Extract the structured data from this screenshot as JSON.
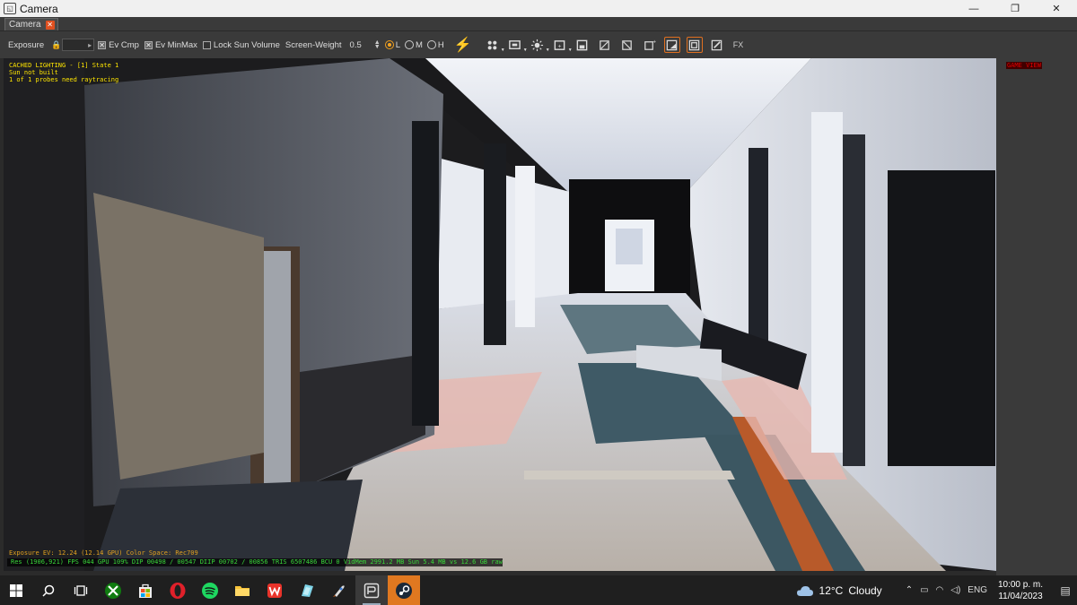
{
  "window": {
    "title": "Camera",
    "tab_label": "Camera"
  },
  "win_controls": {
    "minimize": "—",
    "restore": "❐",
    "close": "✕"
  },
  "toolbar": {
    "exposure_label": "Exposure",
    "ev_cmp_label": "Ev Cmp",
    "ev_minmax_label": "Ev MinMax",
    "lock_sun_volume_label": "Lock Sun Volume",
    "screen_weight_label": "Screen-Weight",
    "screen_weight_value": "0.5",
    "radio_l": "L",
    "radio_m": "M",
    "radio_h": "H",
    "selected_quality": "L",
    "ev_cmp_checked": true,
    "ev_minmax_checked": true,
    "lock_sun_volume_checked": false,
    "fx_label": "FX"
  },
  "viewport": {
    "status_lines": [
      "CACHED LIGHTING - [1] State 1",
      "Sun not built",
      "1 of 1 probes need raytracing"
    ],
    "game_view_label": "GAME VIEW",
    "exposure_line": "Exposure EV: 12.24 (12.14 GPU)  Color Space: Rec709",
    "stats_line": "Res (1906,921)   FPS 044   GPU 109%   DIP 00498 / 00547  DIIP 00702 / 00856  TRIS 6507486  BCU 0  VidMem 2991.2 MB   Sun 5.4 MB vs 12.6 GB raw"
  },
  "taskbar": {
    "apps": [
      "windows-start",
      "search",
      "task-view",
      "xbox",
      "microsoft-store",
      "opera",
      "spotify",
      "file-explorer",
      "wps-office",
      "photo-app",
      "rocket-app",
      "camera-app",
      "steam"
    ],
    "weather_temp": "12°C",
    "weather_desc": "Cloudy",
    "language": "ENG",
    "time": "10:00 p. m.",
    "date": "11/04/2023"
  },
  "colors": {
    "accent": "#e07020",
    "status_yellow": "#ffe600",
    "stats_green": "#39d639",
    "game_view_red": "#e00000"
  }
}
